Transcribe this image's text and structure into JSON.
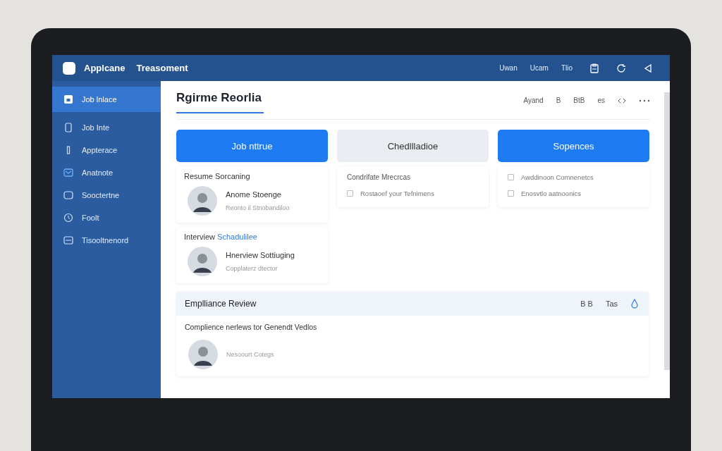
{
  "app": {
    "name": "Applcane",
    "title": "Treasoment"
  },
  "topbar_links": [
    "Uwan",
    "Ucam",
    "Tlio"
  ],
  "sidebar": {
    "items": [
      {
        "label": "Job lnlace",
        "selected": true
      },
      {
        "label": "Job Inte",
        "selected": false
      },
      {
        "label": "Appterace",
        "selected": false
      },
      {
        "label": "Anatnote",
        "selected": false
      },
      {
        "label": "Sooctertne",
        "selected": false
      },
      {
        "label": "Foolt",
        "selected": false
      },
      {
        "label": "Tisooltnenord",
        "selected": false
      }
    ]
  },
  "page": {
    "title": "Rgirme Reorlia",
    "toolbar": [
      "Ayand",
      "B",
      "BtB",
      "es"
    ]
  },
  "columns": [
    {
      "header": "Job nttrue",
      "selected": true,
      "cards": [
        {
          "title": "Resume Sorcaning",
          "name": "Anome Stoenge",
          "subtitle": "Reonto il Stnobandiloo"
        },
        {
          "title": "Interview ",
          "title_link": "Schadulilee",
          "name": "Hnerview Sottiuging",
          "subtitle": "Copplaterz dtector"
        }
      ]
    },
    {
      "header": "Chedllladioe",
      "selected": false,
      "items": [
        {
          "kind": "title",
          "text": "Condrifate Mrecrcas"
        },
        {
          "kind": "checkbox",
          "text": "Rostaoef your Tefnimens",
          "checked": false
        }
      ]
    },
    {
      "header": "Sopences",
      "selected": true,
      "items": [
        {
          "kind": "checkbox",
          "text": "Awddinoon Comnenetcs",
          "checked": false
        },
        {
          "kind": "checkbox",
          "text": "Enosvtlo aatnoonics",
          "checked": false
        }
      ]
    }
  ],
  "review": {
    "title": "Emplliance Review",
    "actions": [
      "B B",
      "Tas"
    ],
    "text": "Complience nerlews tor Genendt Vedlos",
    "name": "Nesoourt Cotegs"
  }
}
